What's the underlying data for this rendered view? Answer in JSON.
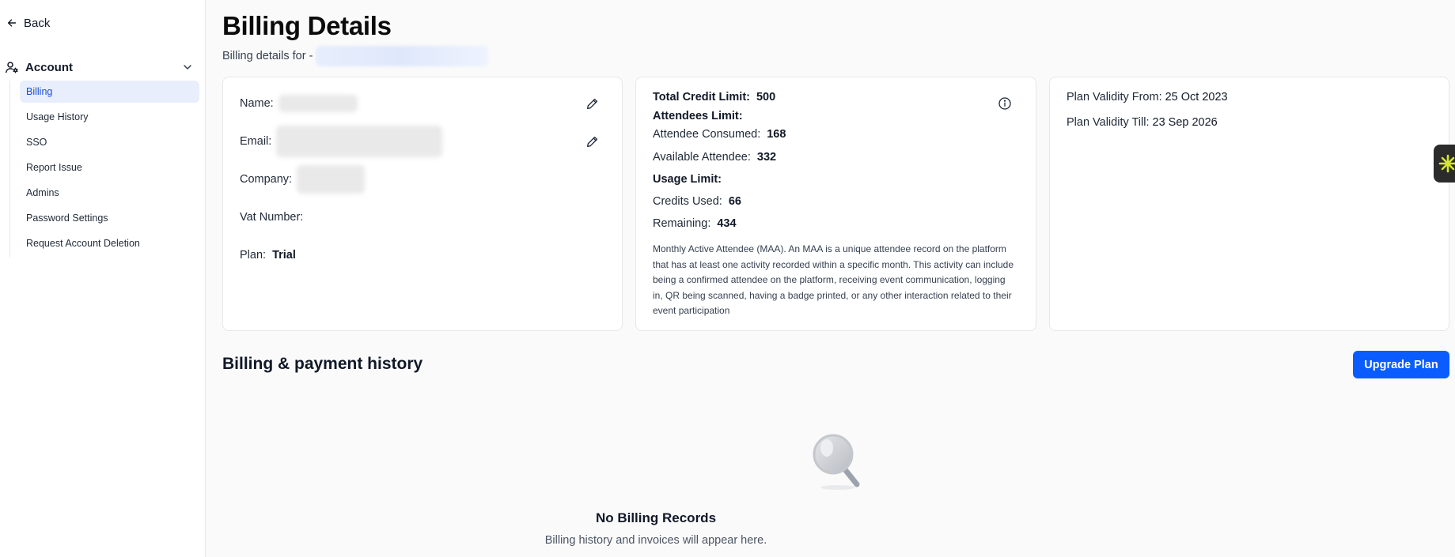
{
  "sidebar": {
    "back_label": "Back",
    "group_label": "Account",
    "items": [
      {
        "label": "Billing",
        "active": true
      },
      {
        "label": "Usage History"
      },
      {
        "label": "SSO"
      },
      {
        "label": "Report Issue"
      },
      {
        "label": "Admins"
      },
      {
        "label": "Password Settings"
      },
      {
        "label": "Request Account Deletion"
      }
    ]
  },
  "header": {
    "title": "Billing Details",
    "subtitle_prefix": "Billing details for -"
  },
  "profile_card": {
    "name_label": "Name:",
    "email_label": "Email:",
    "company_label": "Company:",
    "vat_label": "Vat Number:",
    "plan_label": "Plan:",
    "plan_value": "Trial"
  },
  "limits_card": {
    "total_credit_label": "Total Credit Limit:",
    "total_credit_value": "500",
    "attendees_limit_label": "Attendees Limit:",
    "attendee_consumed_label": "Attendee Consumed:",
    "attendee_consumed_value": "168",
    "available_attendee_label": "Available Attendee:",
    "available_attendee_value": "332",
    "usage_limit_label": "Usage Limit:",
    "credits_used_label": "Credits Used:",
    "credits_used_value": "66",
    "remaining_label": "Remaining:",
    "remaining_value": "434",
    "maa_description": "Monthly Active Attendee (MAA). An MAA is a unique attendee record on the platform that has at least one activity recorded within a specific month. This activity can include being a confirmed attendee on the platform, receiving event communication, logging in, QR being scanned, having a badge printed, or any other interaction related to their event participation"
  },
  "validity_card": {
    "from_label": "Plan Validity From:",
    "from_value": "25 Oct 2023",
    "till_label": "Plan Validity Till:",
    "till_value": "23 Sep 2026"
  },
  "history": {
    "title": "Billing & payment history",
    "upgrade_label": "Upgrade Plan",
    "empty_title": "No Billing Records",
    "empty_subtitle": "Billing history and invoices will appear here."
  },
  "colors": {
    "accent": "#0b5cff",
    "active_nav_bg": "#e8eefc",
    "active_nav_text": "#1d4ed8",
    "widget_bg": "#2b2b2b",
    "widget_icon": "#d4e72a"
  },
  "icons": {
    "back": "arrow-left-icon",
    "account": "user-settings-icon",
    "group_toggle": "chevron-down-icon",
    "edit": "pencil-icon",
    "info": "info-icon",
    "empty_state": "magnifier-icon",
    "widget": "asterisk-icon"
  }
}
